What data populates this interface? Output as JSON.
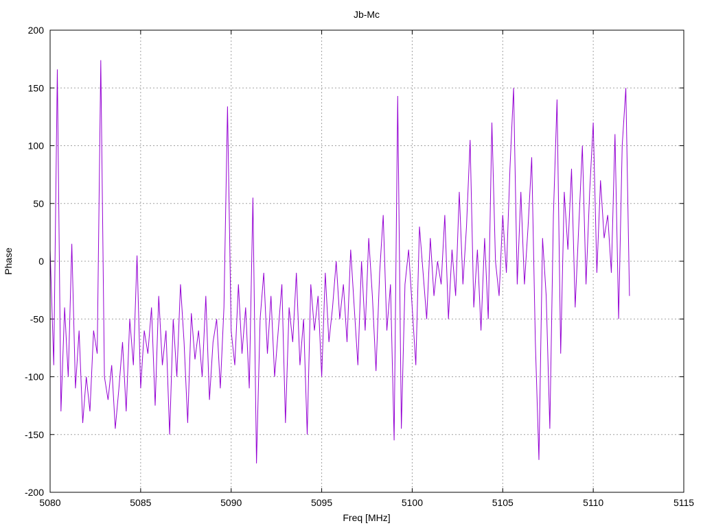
{
  "chart_data": {
    "type": "line",
    "title": "Jb-Mc",
    "xlabel": "Freq [MHz]",
    "ylabel": "Phase",
    "xlim": [
      5080,
      5115
    ],
    "ylim": [
      -200,
      200
    ],
    "xticks": [
      5080,
      5085,
      5090,
      5095,
      5100,
      5105,
      5110,
      5115
    ],
    "yticks": [
      -200,
      -150,
      -100,
      -50,
      0,
      50,
      100,
      150,
      200
    ],
    "grid": true,
    "legend": "none",
    "series": [
      {
        "name": "Jb-Mc",
        "color": "#9400d3",
        "x_start": 5080,
        "x_step": 0.2,
        "values": [
          10,
          -90,
          166,
          -130,
          -40,
          -100,
          15,
          -110,
          -60,
          -140,
          -100,
          -130,
          -60,
          -80,
          174,
          -100,
          -120,
          -90,
          -145,
          -110,
          -70,
          -130,
          -50,
          -90,
          5,
          -110,
          -60,
          -80,
          -40,
          -125,
          -30,
          -90,
          -60,
          -150,
          -50,
          -100,
          -20,
          -70,
          -140,
          -45,
          -85,
          -60,
          -100,
          -30,
          -120,
          -70,
          -50,
          -110,
          -40,
          134,
          -60,
          -90,
          -20,
          -80,
          -40,
          -110,
          55,
          -175,
          -50,
          -10,
          -80,
          -30,
          -100,
          -60,
          -20,
          -140,
          -40,
          -70,
          -10,
          -90,
          -50,
          -150,
          -20,
          -60,
          -30,
          -100,
          -10,
          -70,
          -40,
          0,
          -50,
          -20,
          -70,
          10,
          -40,
          -90,
          0,
          -60,
          20,
          -30,
          -95,
          -10,
          40,
          -60,
          -20,
          -155,
          143,
          -145,
          -20,
          10,
          -40,
          -90,
          30,
          -10,
          -50,
          20,
          -30,
          0,
          -20,
          40,
          -50,
          10,
          -30,
          60,
          -20,
          30,
          105,
          -40,
          10,
          -60,
          20,
          -50,
          120,
          0,
          -30,
          40,
          -10,
          80,
          150,
          -20,
          60,
          -20,
          30,
          90,
          -70,
          -172,
          20,
          -30,
          -145,
          40,
          140,
          -80,
          60,
          10,
          80,
          -40,
          30,
          100,
          -20,
          60,
          120,
          -10,
          70,
          20,
          40,
          -10,
          110,
          -50,
          100,
          150,
          -30
        ]
      }
    ]
  }
}
